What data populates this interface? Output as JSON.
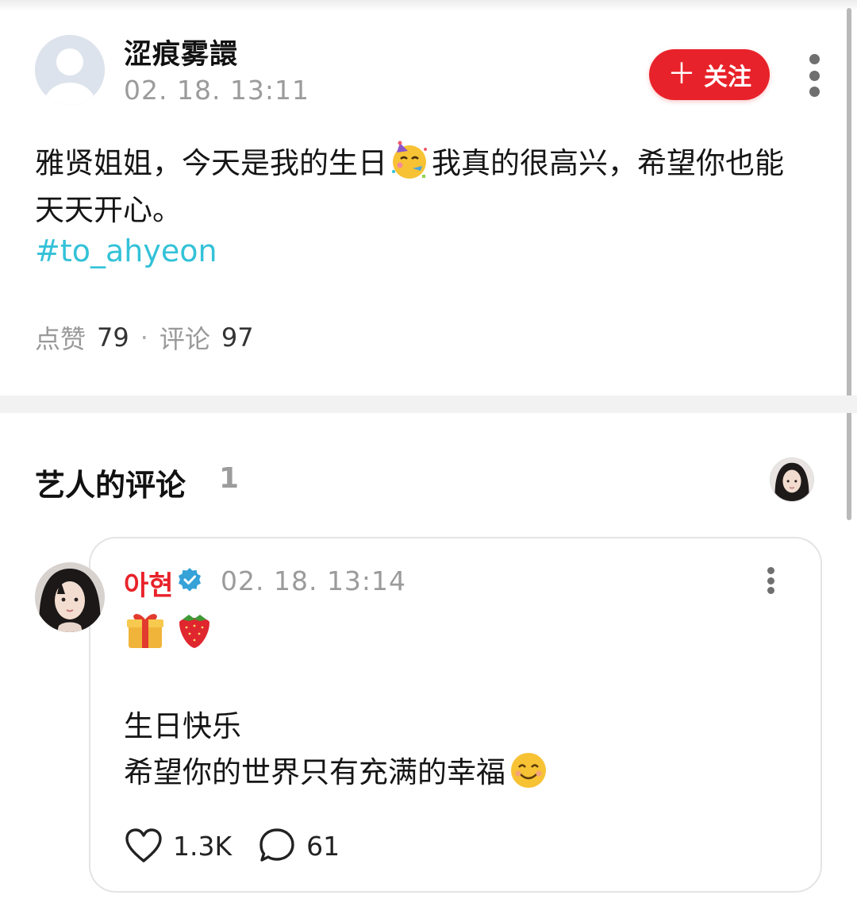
{
  "post": {
    "username": "涩痕雾譞",
    "timestamp": "02. 18. 13:11",
    "follow_label": "关注",
    "follow_plus": "＋",
    "text_part1": "雅贤姐姐，今天是我的生日",
    "text_emoji": "partying-face",
    "text_part2": "我真的很高兴，希望你也能天天开心。",
    "hashtag": "#to_ahyeon",
    "likes_label": "点赞",
    "likes_count": "79",
    "separator": "·",
    "comments_label": "评论",
    "comments_count": "97"
  },
  "artist_comments": {
    "title": "艺人的评论",
    "count": "1"
  },
  "comment": {
    "author": "아현",
    "verified": true,
    "timestamp": "02. 18. 13:14",
    "emojis": [
      "wrapped-gift",
      "strawberry"
    ],
    "line1": "生日快乐",
    "line2": "希望你的世界只有充满的幸福",
    "line2_emoji": "smiling-face",
    "like_count": "1.3K",
    "reply_count": "61"
  },
  "colors": {
    "accent_red": "#e8222a",
    "hashtag_cyan": "#33c2d8",
    "muted_gray": "#9b9b9b",
    "verified_blue": "#35a2d8"
  },
  "icons": {
    "more": "more-vertical-icon",
    "verified": "verified-badge-icon",
    "like": "heart-outline-icon",
    "reply": "speech-bubble-icon"
  }
}
